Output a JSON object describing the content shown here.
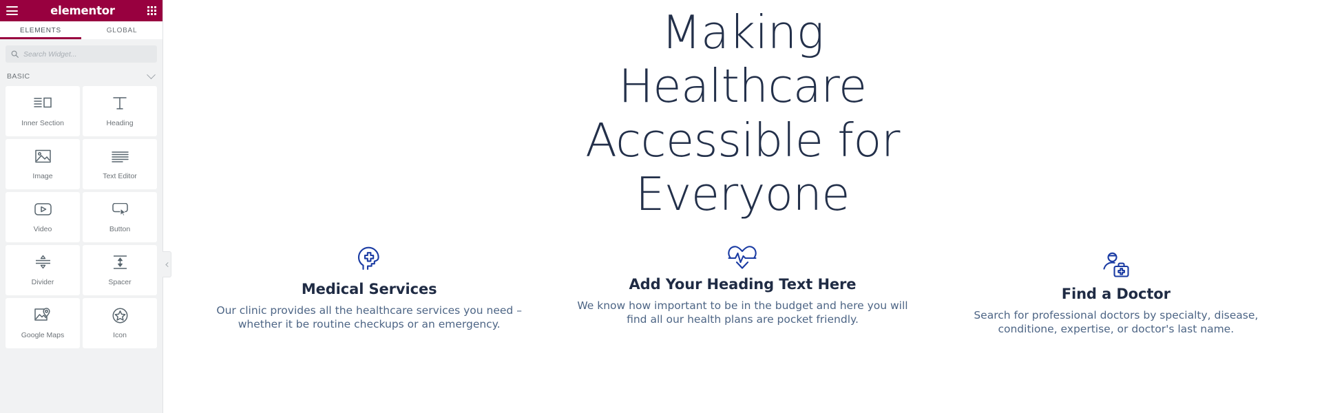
{
  "panel": {
    "brand": "elementor",
    "menu_icon": "hamburger-icon",
    "grid_icon": "apps-grid-icon",
    "tabs": [
      {
        "label": "ELEMENTS",
        "active": true
      },
      {
        "label": "GLOBAL",
        "active": false
      }
    ],
    "search": {
      "placeholder": "Search Widget...",
      "value": "",
      "icon": "search-icon"
    },
    "category": {
      "label": "BASIC",
      "toggle_icon": "chevron-down-icon"
    },
    "widgets": [
      {
        "label": "Inner Section",
        "icon": "inner-section-icon"
      },
      {
        "label": "Heading",
        "icon": "heading-t-icon"
      },
      {
        "label": "Image",
        "icon": "image-icon"
      },
      {
        "label": "Text Editor",
        "icon": "text-editor-icon"
      },
      {
        "label": "Video",
        "icon": "video-play-icon"
      },
      {
        "label": "Button",
        "icon": "button-cursor-icon"
      },
      {
        "label": "Divider",
        "icon": "divider-icon"
      },
      {
        "label": "Spacer",
        "icon": "spacer-icon"
      },
      {
        "label": "Google Maps",
        "icon": "google-maps-icon"
      },
      {
        "label": "Icon",
        "icon": "star-circle-icon"
      }
    ],
    "collapse": {
      "icon": "chevron-left-icon"
    }
  },
  "canvas": {
    "hero_title": "Making Healthcare Accessible for Everyone",
    "features": [
      {
        "icon": "head-medical-cross-icon",
        "title": "Medical Services",
        "text": "Our clinic provides all the healthcare services you need – whether it be routine checkups or an emergency."
      },
      {
        "icon": "heart-pulse-icon",
        "title": "Add Your Heading Text Here",
        "text": "We know how important to be in the budget and here you will find all our health plans are pocket friendly."
      },
      {
        "icon": "doctor-bag-icon",
        "title": "Find a Doctor",
        "text": "Search for professional doctors by specialty, disease, conditione, expertise, or doctor's last name."
      }
    ]
  },
  "colors": {
    "brand_crimson": "#98003f",
    "panel_bg": "#f1f2f3",
    "heading_navy": "#23304a",
    "icon_blue": "#1a3ba3",
    "body_text": "#4d6585"
  }
}
